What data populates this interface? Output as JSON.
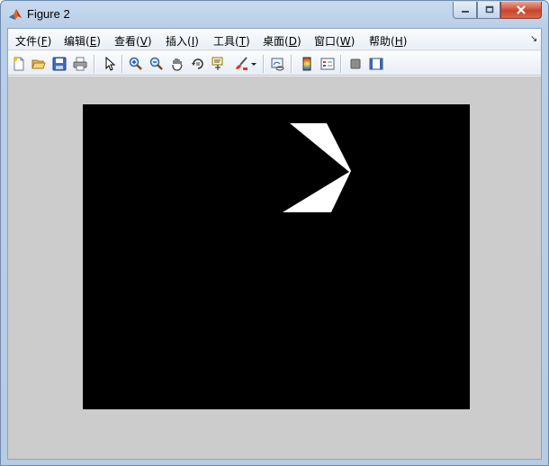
{
  "window": {
    "title": "Figure 2"
  },
  "menubar": {
    "items": [
      {
        "label": "文件(",
        "acc": "F",
        "end": ")"
      },
      {
        "label": "编辑(",
        "acc": "E",
        "end": ")"
      },
      {
        "label": "查看(",
        "acc": "V",
        "end": ")"
      },
      {
        "label": "插入(",
        "acc": "I",
        "end": ")"
      },
      {
        "label": "工具(",
        "acc": "T",
        "end": ")"
      },
      {
        "label": "桌面(",
        "acc": "D",
        "end": ")"
      },
      {
        "label": "窗口(",
        "acc": "W",
        "end": ")"
      },
      {
        "label": "帮助(",
        "acc": "H",
        "end": ")"
      }
    ]
  },
  "toolbar": {
    "icons": [
      "new-figure-icon",
      "open-file-icon",
      "save-icon",
      "print-icon",
      "pointer-icon",
      "zoom-in-icon",
      "zoom-out-icon",
      "pan-icon",
      "rotate-3d-icon",
      "data-cursor-icon",
      "brush-icon",
      "brush-dropdown-icon",
      "link-plot-icon",
      "colorbar-icon",
      "legend-icon",
      "hide-plot-tools-icon",
      "show-plot-tools-icon"
    ]
  },
  "plot": {
    "background": "#000000",
    "figure_background": "#cccccc",
    "shape_color": "#ffffff"
  }
}
